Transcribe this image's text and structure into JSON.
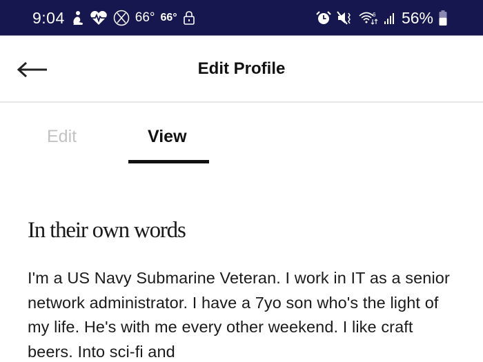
{
  "status_bar": {
    "time": "9:04",
    "temperature_1": "66°",
    "temperature_2": "66°",
    "battery_percent": "56%",
    "battery_level": 0.56,
    "icons": [
      "meditation-icon",
      "heart-rate-icon",
      "x-circle-icon",
      "lock-icon",
      "alarm-icon",
      "mute-vibrate-icon",
      "wifi-6-icon",
      "cell-signal-icon",
      "battery-icon"
    ],
    "background_color": "#17174f"
  },
  "header": {
    "title": "Edit Profile",
    "back_icon": "arrow-left-icon"
  },
  "tabs": [
    {
      "label": "Edit",
      "active": false
    },
    {
      "label": "View",
      "active": true
    }
  ],
  "profile": {
    "section_title": "In their own words",
    "bio": "I'm a US Navy Submarine Veteran. I work in IT as a senior network administrator. I have a 7yo son who's the light of my life. He's with me every other weekend. I like craft beers. Into sci-fi and"
  }
}
